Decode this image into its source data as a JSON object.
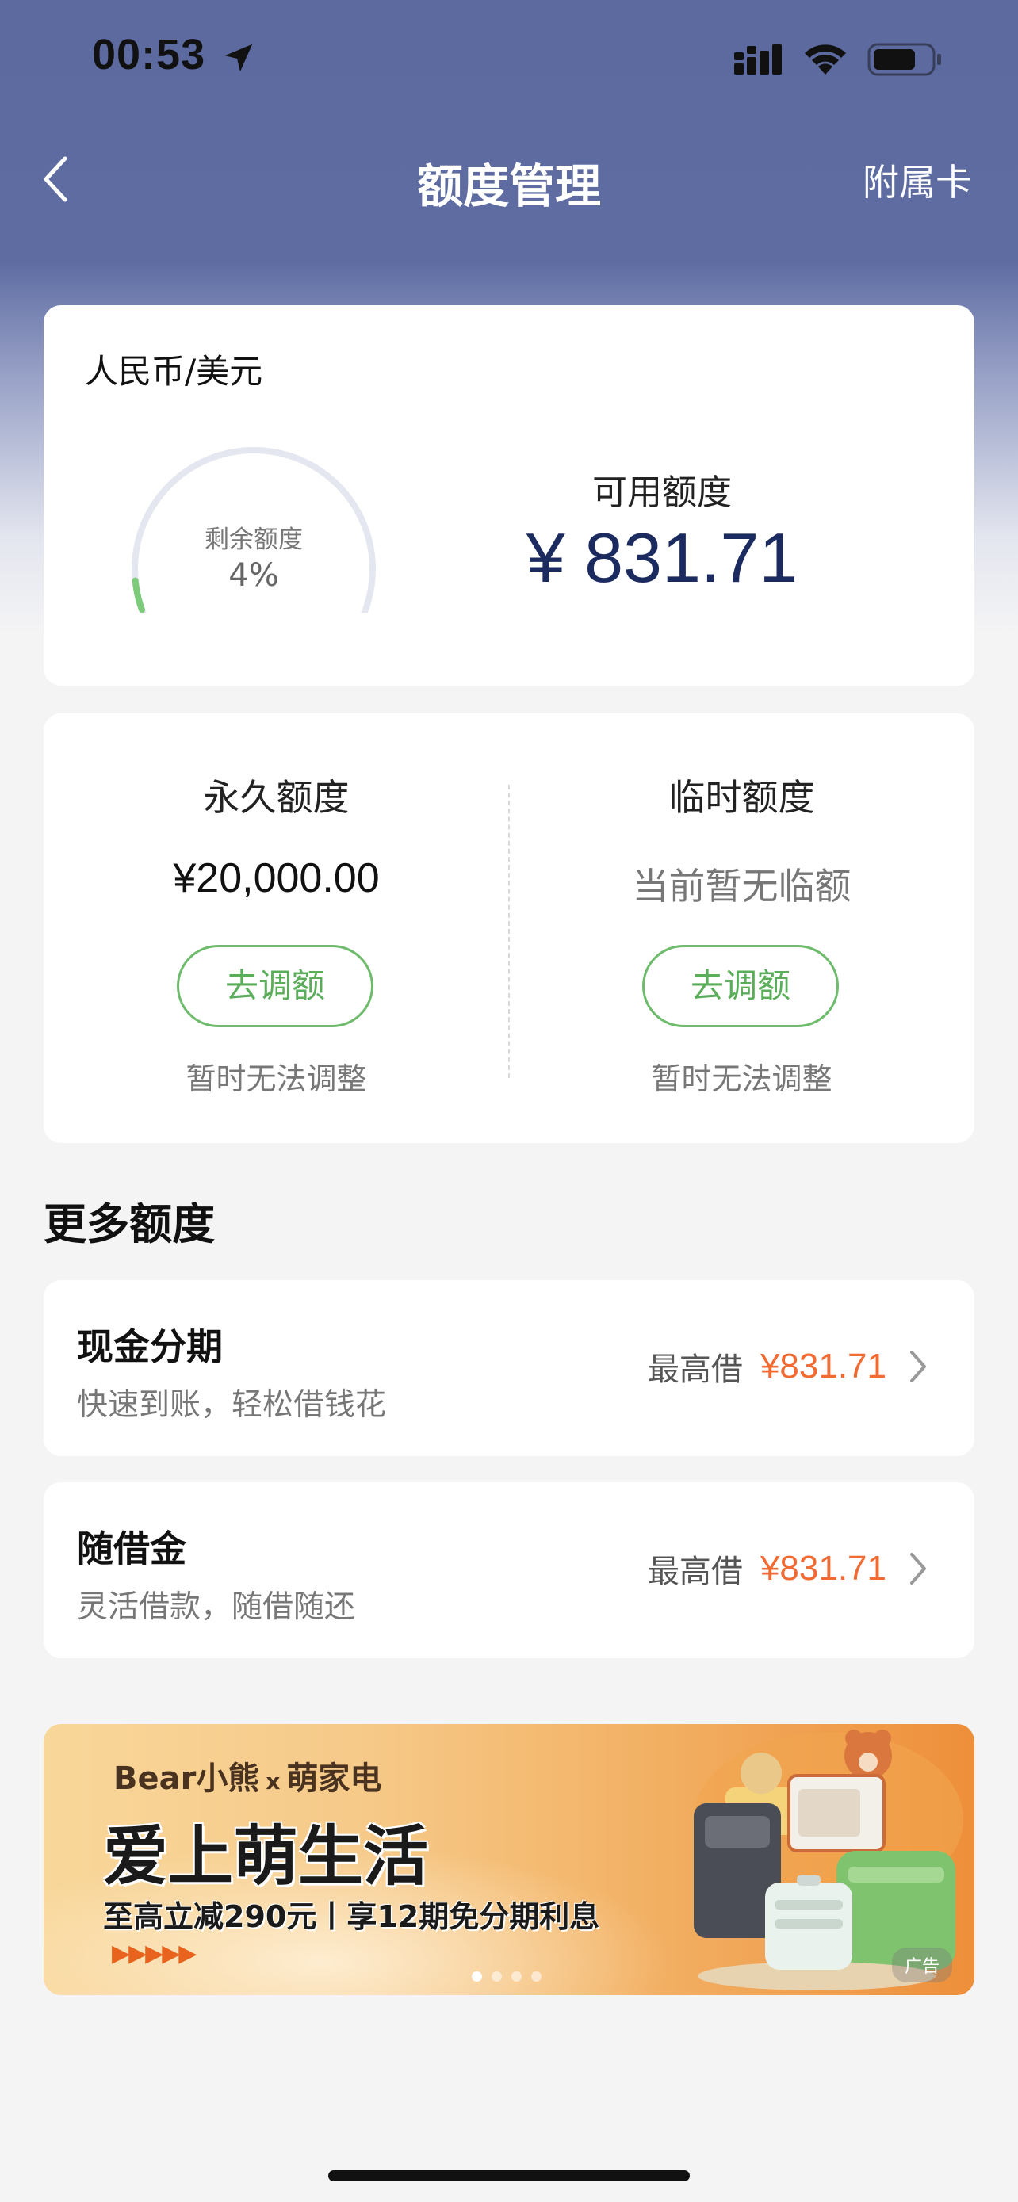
{
  "status_bar": {
    "time": "00:53"
  },
  "nav": {
    "title": "额度管理",
    "right_label": "附属卡"
  },
  "summary": {
    "currency": "人民币/美元",
    "gauge_label": "剩余额度",
    "gauge_value": "4%",
    "gauge_fraction": 0.04,
    "available_label": "可用额度",
    "available_amount": "¥ 831.71"
  },
  "limits": {
    "permanent": {
      "title": "永久额度",
      "value": "¥20,000.00",
      "button": "去调额",
      "note": "暂时无法调整"
    },
    "temporary": {
      "title": "临时额度",
      "value": "当前暂无临额",
      "button": "去调额",
      "note": "暂时无法调整"
    }
  },
  "more": {
    "title": "更多额度",
    "items": [
      {
        "title": "现金分期",
        "subtitle": "快速到账，轻松借钱花",
        "prefix": "最高借",
        "amount": "¥831.71"
      },
      {
        "title": "随借金",
        "subtitle": "灵活借款，随借随还",
        "prefix": "最高借",
        "amount": "¥831.71"
      }
    ]
  },
  "banner": {
    "brand": "Bear小熊",
    "brand_x": "x",
    "brand_partner": "萌家电",
    "headline": "爱上萌生活",
    "subline": "至高立减290元丨享12期免分期利息",
    "arrows": "▶▶▶▶▶",
    "ad_label": "广告",
    "page_count": 4,
    "active_page": 0
  },
  "colors": {
    "header_bg": "#5c6aa0",
    "amount_navy": "#1b2b5f",
    "accent_green": "#5aae5a",
    "accent_orange": "#f06a32"
  }
}
